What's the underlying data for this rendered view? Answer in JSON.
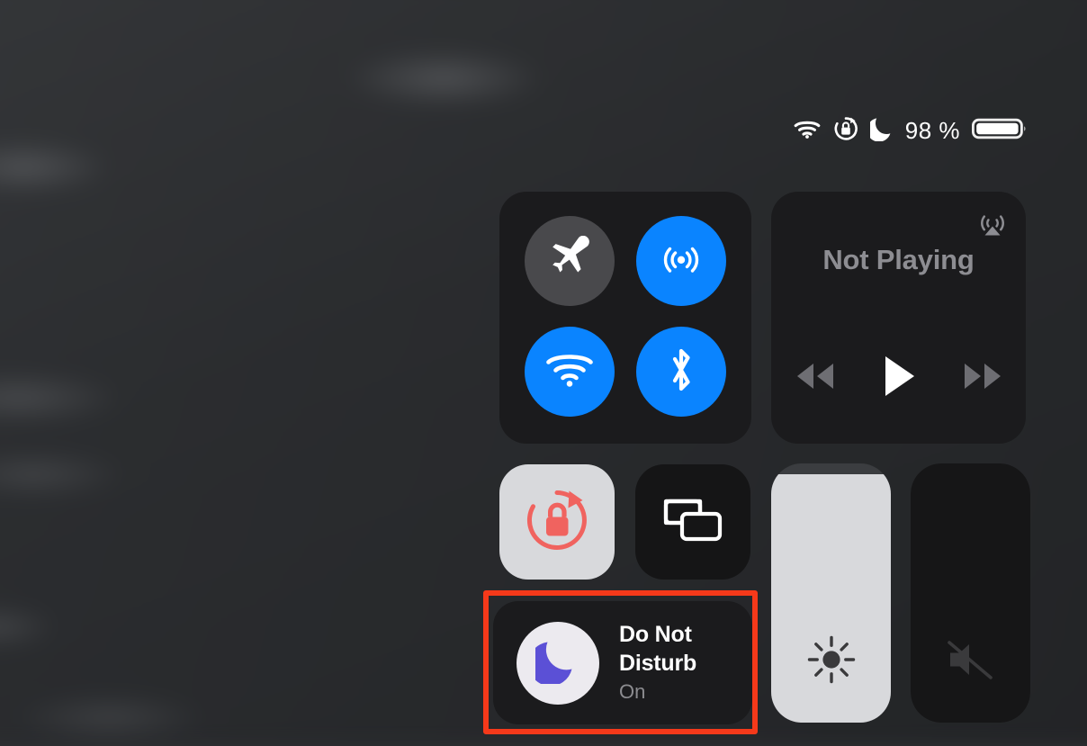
{
  "status_bar": {
    "wifi_icon": "wifi-icon",
    "rotation_lock_icon": "rotation-lock-icon",
    "do_not_disturb_icon": "moon-icon",
    "battery_percent": "98 %",
    "battery_icon": "battery-full-icon"
  },
  "control_center": {
    "connectivity": {
      "toggles": [
        {
          "name": "airplane-mode",
          "icon": "airplane-icon",
          "state": "off"
        },
        {
          "name": "airdrop",
          "icon": "airdrop-icon",
          "state": "on"
        },
        {
          "name": "wifi",
          "icon": "wifi-icon",
          "state": "on"
        },
        {
          "name": "bluetooth",
          "icon": "bluetooth-icon",
          "state": "on"
        }
      ]
    },
    "media": {
      "title": "Not Playing",
      "airplay_icon": "airplay-icon",
      "controls": [
        {
          "name": "rewind",
          "icon": "rewind-icon"
        },
        {
          "name": "play",
          "icon": "play-icon"
        },
        {
          "name": "fast-forward",
          "icon": "fast-forward-icon"
        }
      ]
    },
    "rotation_lock": {
      "icon": "rotation-lock-icon",
      "state": "on"
    },
    "screen_mirroring": {
      "icon": "screen-mirroring-icon",
      "state": "off"
    },
    "brightness": {
      "icon": "brightness-icon",
      "level_percent": 96
    },
    "volume": {
      "icon": "volume-muted-icon",
      "level_percent": 0
    },
    "do_not_disturb": {
      "title": "Do Not Disturb",
      "status": "On",
      "icon": "moon-icon"
    }
  },
  "annotation": {
    "highlight_color": "#f5391a",
    "target": "do-not-disturb-tile"
  },
  "colors": {
    "accent_blue": "#0a84ff",
    "toggle_off_gray": "#49494c",
    "tile_background": "#1b1b1d",
    "active_light": "#d8d9dc",
    "moon_purple": "#5b50d6",
    "lock_red": "#f0635f",
    "secondary_text": "#8d8d92"
  }
}
